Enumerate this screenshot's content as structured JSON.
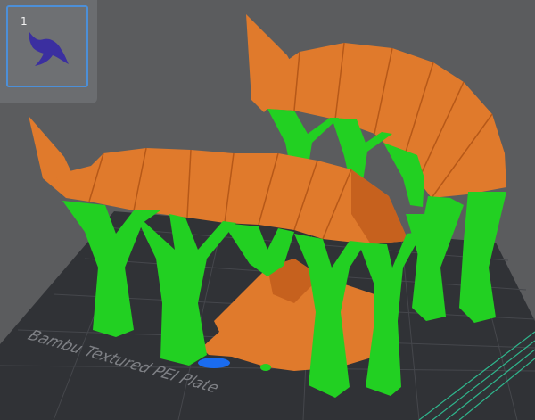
{
  "plate_thumbnail": {
    "number": "1",
    "icon": "part-silhouette-icon"
  },
  "build_plate": {
    "label": "Bambu Textured PEI Plate"
  },
  "colors": {
    "background": "#5b5c5e",
    "plate": "#303236",
    "plate_grid": "#4a4c51",
    "support": "#22d022",
    "model": "#e07a2c",
    "model_shade": "#c6611e",
    "accent_bottom": "#1a6cf0",
    "selection": "#4c8fd8"
  }
}
